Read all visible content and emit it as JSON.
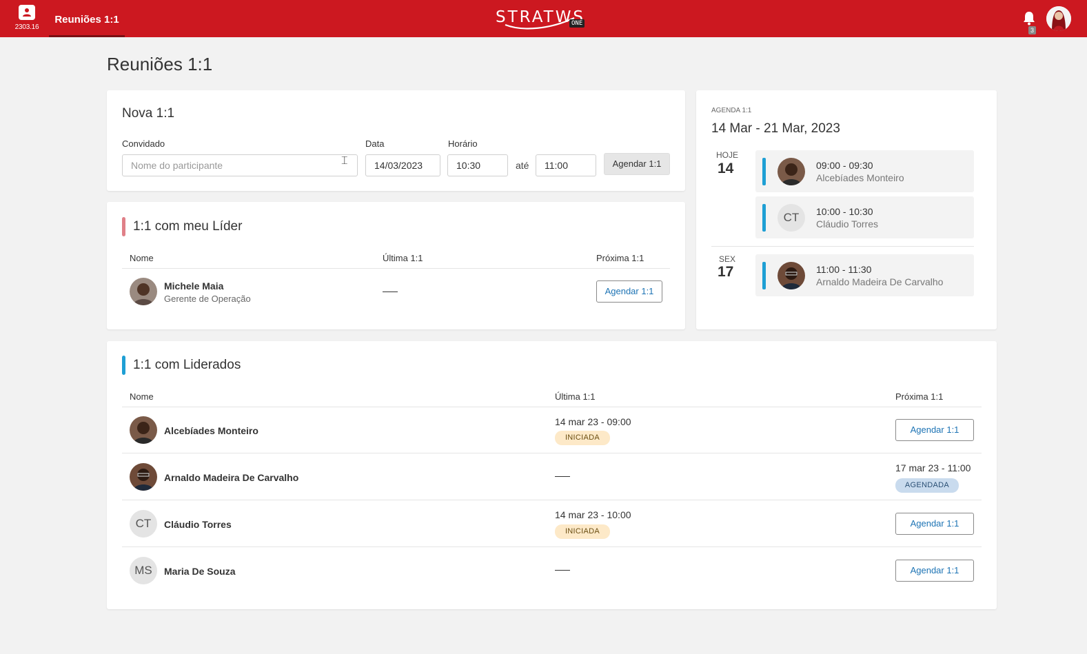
{
  "topbar": {
    "app_code": "2303.16",
    "tab_label": "Reuniões 1:1",
    "brand_text": "STRATWS",
    "brand_suffix": "ONE",
    "notification_count": "3",
    "accent_color": "#cc1820"
  },
  "page": {
    "title": "Reuniões 1:1"
  },
  "nova": {
    "title": "Nova 1:1",
    "convidado_label": "Convidado",
    "convidado_placeholder": "Nome do participante",
    "data_label": "Data",
    "data_value": "14/03/2023",
    "horario_label": "Horário",
    "hora_inicio": "10:30",
    "ate_label": "até",
    "hora_fim": "11:00",
    "submit_label": "Agendar 1:1"
  },
  "lider": {
    "title": "1:1 com meu Líder",
    "accent_color": "#e08088",
    "col_nome": "Nome",
    "col_ultima": "Última 1:1",
    "col_proxima": "Próxima 1:1",
    "row": {
      "name": "Michele Maia",
      "role": "Gerente de Operação",
      "action_label": "Agendar 1:1"
    }
  },
  "agenda": {
    "kicker": "AGENDA 1:1",
    "range": "14 Mar - 21 Mar, 2023",
    "days": [
      {
        "label": "HOJE",
        "num": "14",
        "events": [
          {
            "time": "09:00 - 09:30",
            "name": "Alcebíades Monteiro"
          },
          {
            "time": "10:00 - 10:30",
            "name": "Cláudio Torres",
            "initials": "CT"
          }
        ]
      },
      {
        "label": "SEX",
        "num": "17",
        "events": [
          {
            "time": "11:00 - 11:30",
            "name": "Arnaldo Madeira De Carvalho"
          }
        ]
      }
    ]
  },
  "liderados": {
    "title": "1:1 com Liderados",
    "accent_color": "#1e9fd4",
    "col_nome": "Nome",
    "col_ultima": "Última 1:1",
    "col_proxima": "Próxima 1:1",
    "rows": [
      {
        "name": "Alcebíades Monteiro",
        "ultima": "14 mar 23 - 09:00",
        "ultima_status": "INICIADA",
        "action_label": "Agendar 1:1"
      },
      {
        "name": "Arnaldo Madeira De Carvalho",
        "proxima": "17 mar 23 - 11:00",
        "proxima_status": "AGENDADA"
      },
      {
        "name": "Cláudio Torres",
        "initials": "CT",
        "ultima": "14 mar 23 - 10:00",
        "ultima_status": "INICIADA",
        "action_label": "Agendar 1:1"
      },
      {
        "name": "Maria De Souza",
        "initials": "MS",
        "action_label": "Agendar 1:1"
      }
    ]
  }
}
